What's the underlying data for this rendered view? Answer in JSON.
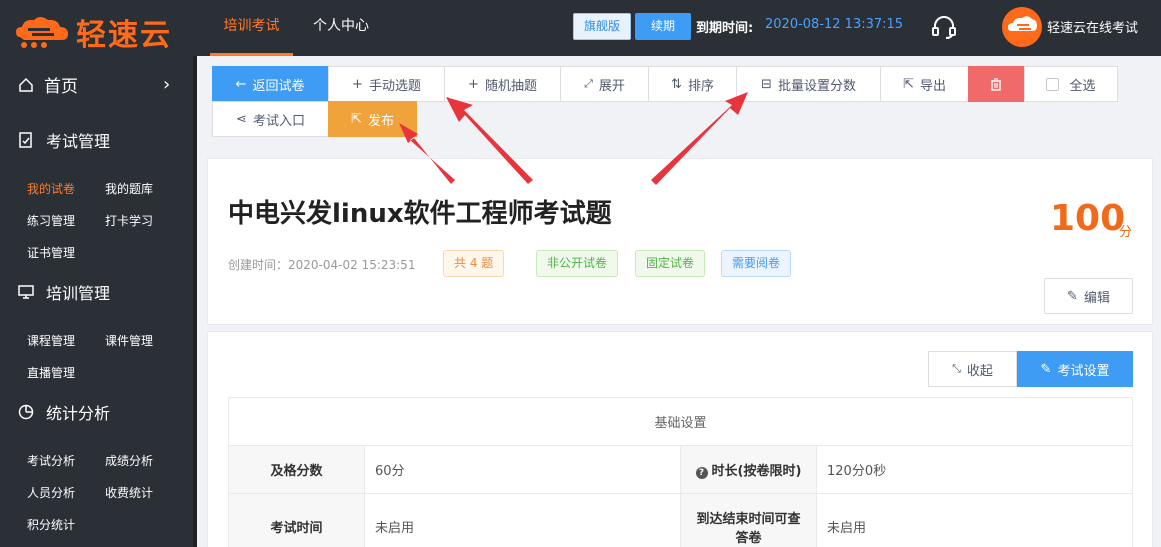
{
  "brand": {
    "name": "轻速云",
    "color": "#ff6a1a"
  },
  "nav": {
    "tabs": [
      {
        "label": "培训考试",
        "active": true
      },
      {
        "label": "个人中心",
        "active": false
      }
    ]
  },
  "account": {
    "edition": "旗舰版",
    "renew": "续期",
    "expire_label": "到期时间:",
    "expire_value": "2020-08-12 13:37:15",
    "user": "轻速云在线考试"
  },
  "sidebar": {
    "home": "首页",
    "groups": [
      {
        "label": "考试管理",
        "icon": "document-icon"
      },
      {
        "label": "培训管理",
        "icon": "monitor-icon"
      },
      {
        "label": "统计分析",
        "icon": "pie-chart-icon"
      }
    ],
    "items": [
      "我的试卷",
      "我的题库",
      "练习管理",
      "打卡学习",
      "证书管理",
      "课程管理",
      "课件管理",
      "直播管理",
      "考试分析",
      "成绩分析",
      "人员分析",
      "收费统计",
      "积分统计"
    ]
  },
  "toolbar": {
    "back": "返回试卷",
    "manual": "手动选题",
    "random": "随机抽题",
    "expand": "展开",
    "sort": "排序",
    "batch_score": "批量设置分数",
    "export": "导出",
    "select_all": "全选",
    "entry": "考试入口",
    "publish": "发布"
  },
  "exam": {
    "title": "中电兴发linux软件工程师考试题",
    "score": "100",
    "score_unit": "分",
    "created": "创建时间：2020-04-02 15:23:51",
    "tags": [
      "共 4 题",
      "非公开试卷",
      "固定试卷",
      "需要阅卷"
    ],
    "edit": "编辑"
  },
  "settings": {
    "collapse": "收起",
    "exam_settings": "考试设置",
    "section_title": "基础设置",
    "rows": [
      {
        "label1": "及格分数",
        "value1": "60分",
        "label2": "时长(按卷限时)",
        "value2": "120分0秒"
      },
      {
        "label1": "考试时间",
        "value1": "未启用",
        "label2": "到达结束时间可查答卷",
        "value2": "未启用"
      }
    ]
  }
}
